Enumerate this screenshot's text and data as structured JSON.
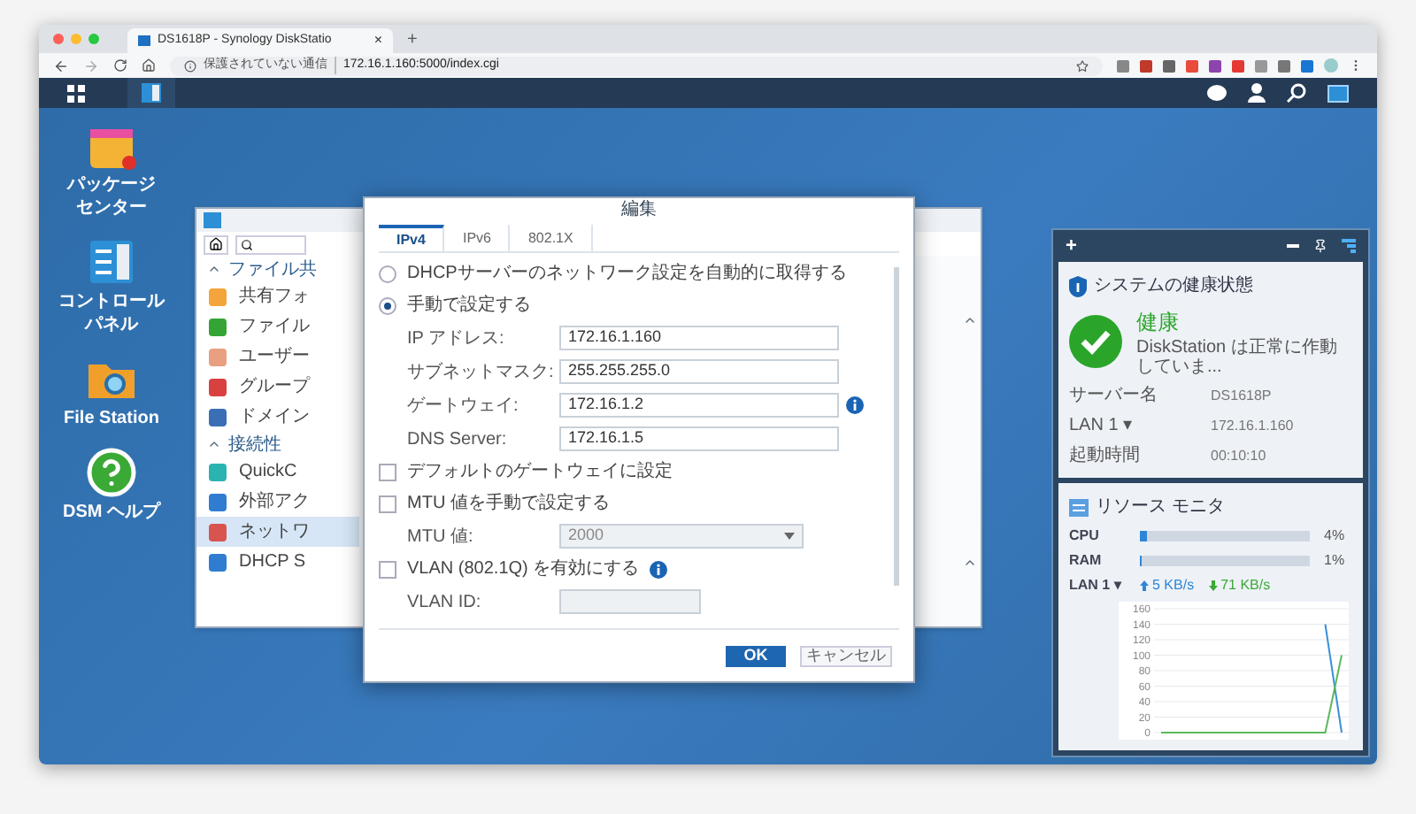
{
  "browser": {
    "tab_title": "DS1618P - Synology DiskStatio",
    "tab_close": "×",
    "new_tab": "+",
    "security_label": "保護されていない通信",
    "url": "172.16.1.160:5000/index.cgi"
  },
  "desktop_icons": [
    {
      "kind": "package",
      "lines": [
        "パッケージ",
        "センター"
      ]
    },
    {
      "kind": "control",
      "lines": [
        "コントロール",
        "パネル"
      ]
    },
    {
      "kind": "folder",
      "lines": [
        "File Station"
      ]
    },
    {
      "kind": "help",
      "lines": [
        "DSM ヘルプ"
      ]
    }
  ],
  "control_panel": {
    "sections": [
      {
        "title": "ファイル共",
        "expanded": true,
        "items": [
          {
            "kind": "share",
            "label": "共有フォ",
            "selected": false
          },
          {
            "kind": "file",
            "label": "ファイル",
            "selected": false
          },
          {
            "kind": "user",
            "label": "ユーザー",
            "selected": false
          },
          {
            "kind": "group",
            "label": "グループ",
            "selected": false
          },
          {
            "kind": "domain",
            "label": "ドメイン",
            "selected": false
          }
        ]
      },
      {
        "title": "接続性",
        "expanded": true,
        "items": [
          {
            "kind": "quick",
            "label": "QuickC",
            "selected": false
          },
          {
            "kind": "globe",
            "label": "外部アク",
            "selected": false
          },
          {
            "kind": "network",
            "label": "ネットワ",
            "selected": true
          },
          {
            "kind": "dhcp",
            "label": "DHCP S",
            "selected": false
          }
        ]
      }
    ]
  },
  "dialog": {
    "title": "編集",
    "tabs": [
      {
        "label": "IPv4",
        "selected": true
      },
      {
        "label": "IPv6",
        "selected": false
      },
      {
        "label": "802.1X",
        "selected": false
      }
    ],
    "rows": [
      {
        "kind": "radio",
        "label": "DHCPサーバーのネットワーク設定を自動的に取得する",
        "selected": false
      },
      {
        "kind": "radio",
        "label": "手動で設定する",
        "selected": true
      },
      {
        "kind": "field",
        "label": "IP アドレス:",
        "value": "172.16.1.160"
      },
      {
        "kind": "field",
        "label": "サブネットマスク:",
        "value": "255.255.255.0"
      },
      {
        "kind": "field",
        "label": "ゲートウェイ:",
        "value": "172.16.1.2",
        "info": true
      },
      {
        "kind": "field",
        "label": "DNS Server:",
        "value": "172.16.1.5"
      },
      {
        "kind": "checkbox",
        "label": "デフォルトのゲートウェイに設定",
        "checked": false
      },
      {
        "kind": "checkbox",
        "label": "MTU 値を手動で設定する",
        "checked": false
      },
      {
        "kind": "select",
        "label": "MTU 値:",
        "value": "2000",
        "disabled": true
      },
      {
        "kind": "checkbox",
        "label": "VLAN (802.1Q) を有効にする",
        "checked": false,
        "info": true
      },
      {
        "kind": "field",
        "label": "VLAN ID:",
        "disabled": true
      }
    ],
    "buttons": [
      {
        "kind": "primary",
        "label": "OK"
      },
      {
        "kind": "secondary",
        "label": "キャンセル"
      }
    ]
  },
  "widgets": {
    "add": "+",
    "health": {
      "title": "システムの健康状態",
      "status": "健康",
      "message": "DiskStation は正常に作動していま...",
      "rows": [
        {
          "label": "サーバー名",
          "value": "DS1618P"
        },
        {
          "label": "LAN 1 ▾",
          "value": "172.16.1.160"
        },
        {
          "label": "起動時間",
          "value": "00:10:10"
        }
      ]
    },
    "resource": {
      "title": "リソース モニタ",
      "meters": [
        {
          "label": "CPU",
          "level": 0.04,
          "reading": "4%"
        },
        {
          "label": "RAM",
          "level": 0.01,
          "reading": "1%"
        }
      ],
      "lan_label": "LAN 1 ▾",
      "upload": "5 KB/s",
      "download": "71 KB/s",
      "chart_data": {
        "type": "line",
        "grid": true,
        "ylim": [
          0,
          160
        ],
        "yticks": [
          0,
          20,
          40,
          60,
          80,
          100,
          120,
          140,
          160
        ],
        "series": [
          {
            "color": "#3b8fd9",
            "values": [
              null,
              null,
              null,
              null,
              null,
              null,
              null,
              null,
              null,
              null,
              140,
              0
            ]
          },
          {
            "color": "#5cb85c",
            "values": [
              0,
              0,
              0,
              0,
              0,
              0,
              0,
              0,
              0,
              0,
              0,
              100
            ]
          }
        ]
      }
    }
  }
}
